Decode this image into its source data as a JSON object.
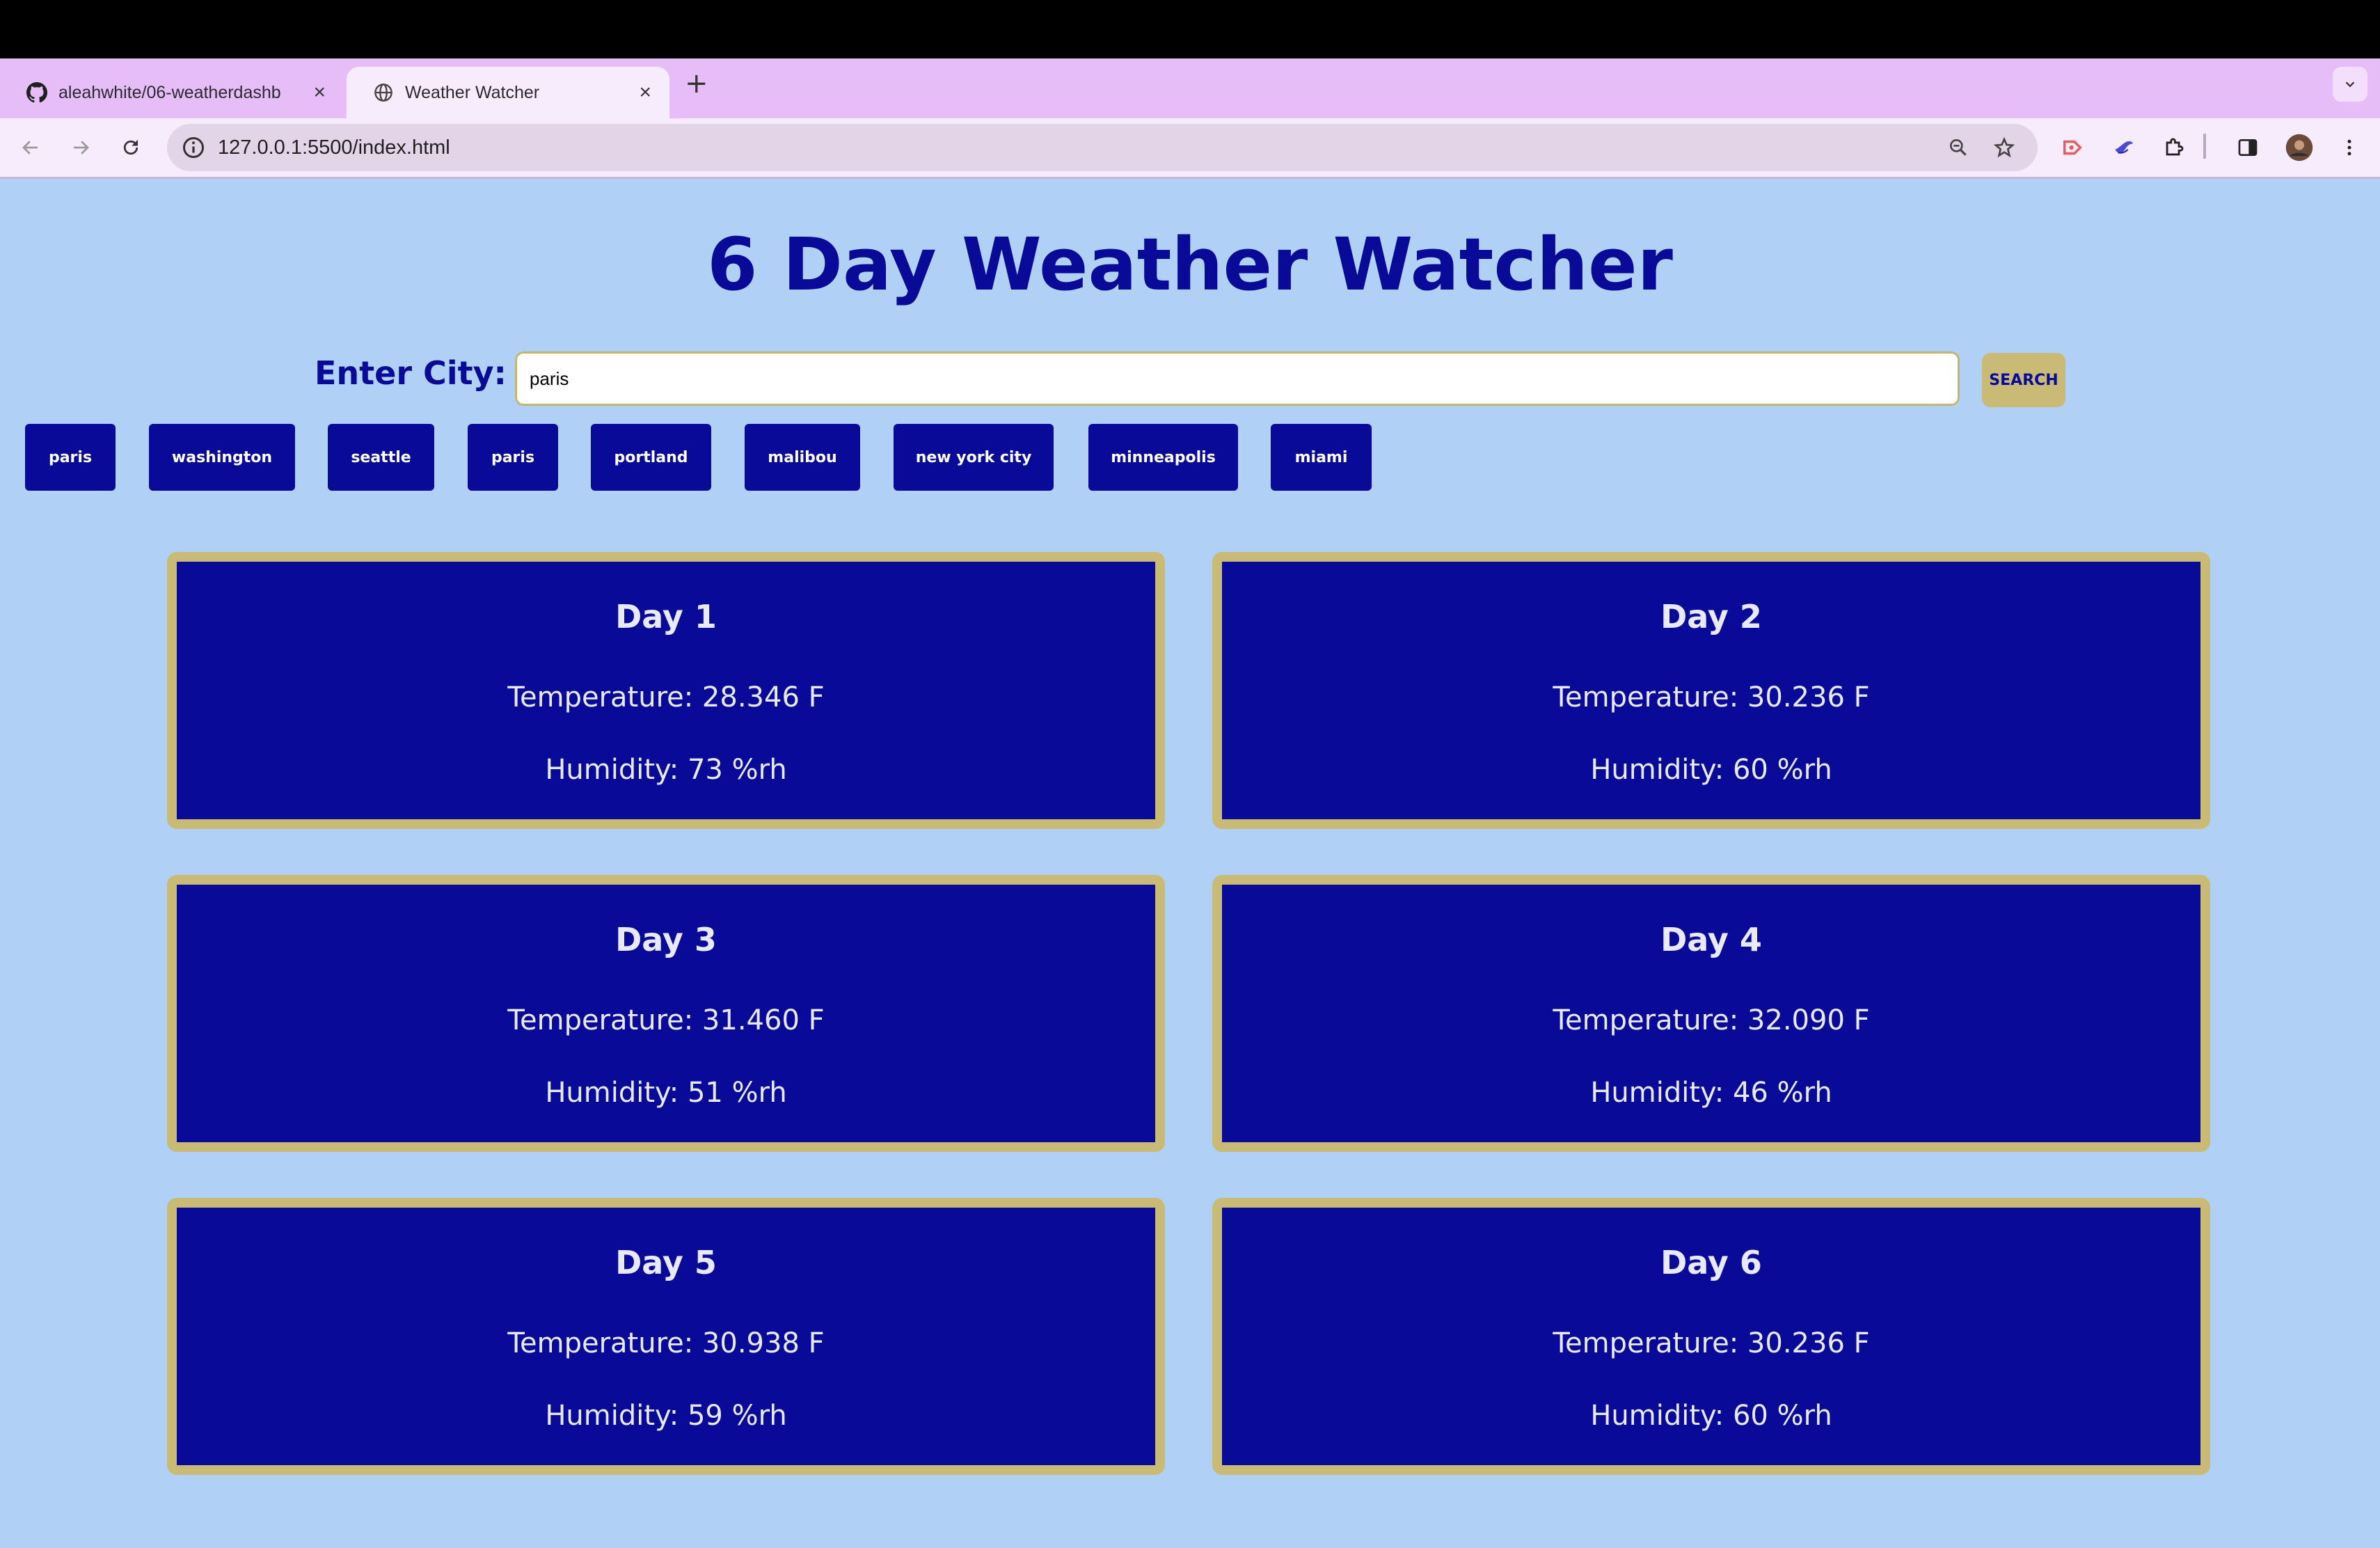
{
  "browser": {
    "tabs": [
      {
        "title": "aleahwhite/06-weatherdashb",
        "icon": "github-icon",
        "active": false
      },
      {
        "title": "Weather Watcher",
        "icon": "globe-icon",
        "active": true
      }
    ],
    "url": "127.0.0.1:5500/index.html"
  },
  "page": {
    "title": "6 Day Weather Watcher",
    "city_label": "Enter City:",
    "search": {
      "value": "paris",
      "button_label": "SEARCH"
    },
    "history": [
      "paris",
      "washington",
      "seattle",
      "paris",
      "portland",
      "malibou",
      "new york city",
      "minneapolis",
      "miami"
    ],
    "forecast": [
      {
        "day": "Day 1",
        "temperature": "Temperature: 28.346 F",
        "humidity": "Humidity: 73 %rh"
      },
      {
        "day": "Day 2",
        "temperature": "Temperature: 30.236 F",
        "humidity": "Humidity: 60 %rh"
      },
      {
        "day": "Day 3",
        "temperature": "Temperature: 31.460 F",
        "humidity": "Humidity: 51 %rh"
      },
      {
        "day": "Day 4",
        "temperature": "Temperature: 32.090 F",
        "humidity": "Humidity: 46 %rh"
      },
      {
        "day": "Day 5",
        "temperature": "Temperature: 30.938 F",
        "humidity": "Humidity: 59 %rh"
      },
      {
        "day": "Day 6",
        "temperature": "Temperature: 30.236 F",
        "humidity": "Humidity: 60 %rh"
      }
    ]
  },
  "colors": {
    "page_background": "#b0d0f5",
    "primary": "#0a0a99",
    "accent_gold": "#c9bb76",
    "tabstrip": "#e6bdf7"
  }
}
